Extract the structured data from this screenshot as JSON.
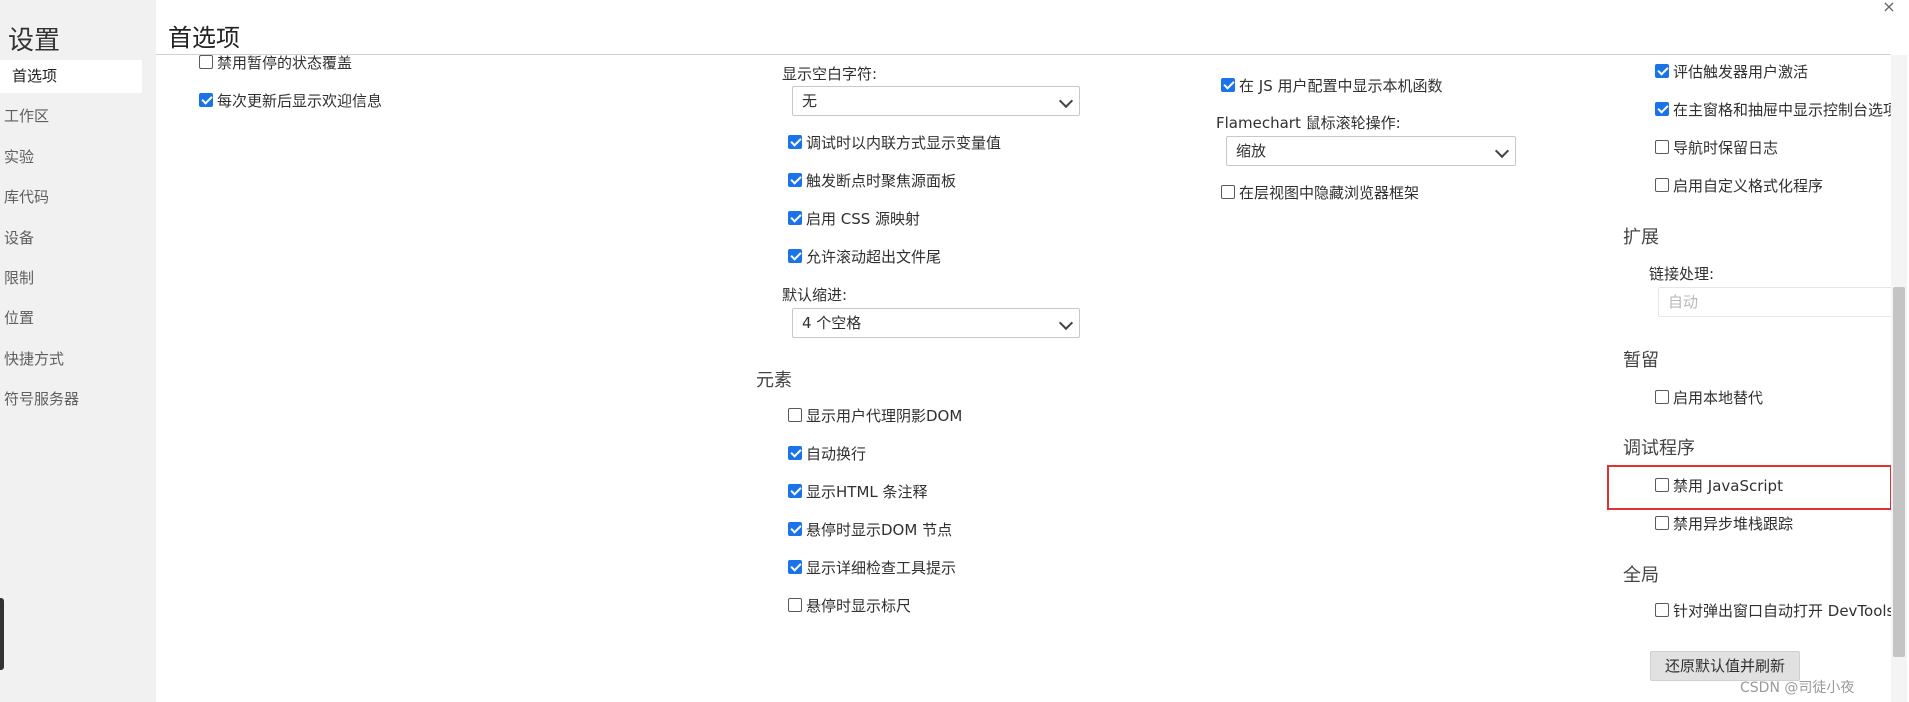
{
  "sidebar": {
    "title": "设置",
    "items": [
      {
        "label": "首选项"
      },
      {
        "label": "工作区"
      },
      {
        "label": "实验"
      },
      {
        "label": "库代码"
      },
      {
        "label": "设备"
      },
      {
        "label": "限制"
      },
      {
        "label": "位置"
      },
      {
        "label": "快捷方式"
      },
      {
        "label": "符号服务器"
      }
    ]
  },
  "header": {
    "title": "首选项",
    "close_glyph": "×"
  },
  "col1": {
    "items": [
      {
        "label": "禁用暂停的状态覆盖",
        "checked": false
      },
      {
        "label": "每次更新后显示欢迎信息",
        "checked": true
      }
    ]
  },
  "col2": {
    "whitespace_label": "显示空白字符:",
    "whitespace_value": "无",
    "items": [
      {
        "label": "调试时以内联方式显示变量值",
        "checked": true
      },
      {
        "label": "触发断点时聚焦源面板",
        "checked": true
      },
      {
        "label": "启用 CSS 源映射",
        "checked": true
      },
      {
        "label": "允许滚动超出文件尾",
        "checked": true
      }
    ],
    "indent_label": "默认缩进:",
    "indent_value": "4 个空格",
    "elements_title": "元素",
    "elements_items": [
      {
        "label": "显示用户代理阴影DOM",
        "checked": false
      },
      {
        "label": "自动换行",
        "checked": true
      },
      {
        "label": "显示HTML 条注释",
        "checked": true
      },
      {
        "label": "悬停时显示DOM 节点",
        "checked": true
      },
      {
        "label": "显示详细检查工具提示",
        "checked": true
      },
      {
        "label": "悬停时显示标尺",
        "checked": false
      }
    ]
  },
  "col3": {
    "native_functions": {
      "label": "在 JS 用户配置中显示本机函数",
      "checked": true
    },
    "flamechart_label": "Flamechart 鼠标滚轮操作:",
    "flamechart_value": "缩放",
    "hide_frames": {
      "label": "在层视图中隐藏浏览器框架",
      "checked": false
    }
  },
  "col4": {
    "top_items": [
      {
        "label": "评估触发器用户激活",
        "checked": true
      },
      {
        "label": "在主窗格和抽屉中显示控制台选项卡",
        "checked": true
      },
      {
        "label": "导航时保留日志",
        "checked": false
      },
      {
        "label": "启用自定义格式化程序",
        "checked": false
      }
    ],
    "extensions_title": "扩展",
    "link_handling_label": "链接处理:",
    "link_handling_value": "自动",
    "persistence_title": "暂留",
    "persistence_items": [
      {
        "label": "启用本地替代",
        "checked": false
      }
    ],
    "debugger_title": "调试程序",
    "debugger_items": [
      {
        "label": "禁用 JavaScript",
        "checked": false
      },
      {
        "label": "禁用异步堆栈跟踪",
        "checked": false
      }
    ],
    "global_title": "全局",
    "global_items": [
      {
        "label": "针对弹出窗口自动打开 DevTools",
        "checked": false
      }
    ],
    "reset_label": "还原默认值并刷新"
  },
  "watermark": "CSDN @司徒小夜",
  "colors": {
    "accent": "#1a73e8",
    "highlight": "#e03232",
    "sidebar_bg": "#f1f1f1"
  }
}
